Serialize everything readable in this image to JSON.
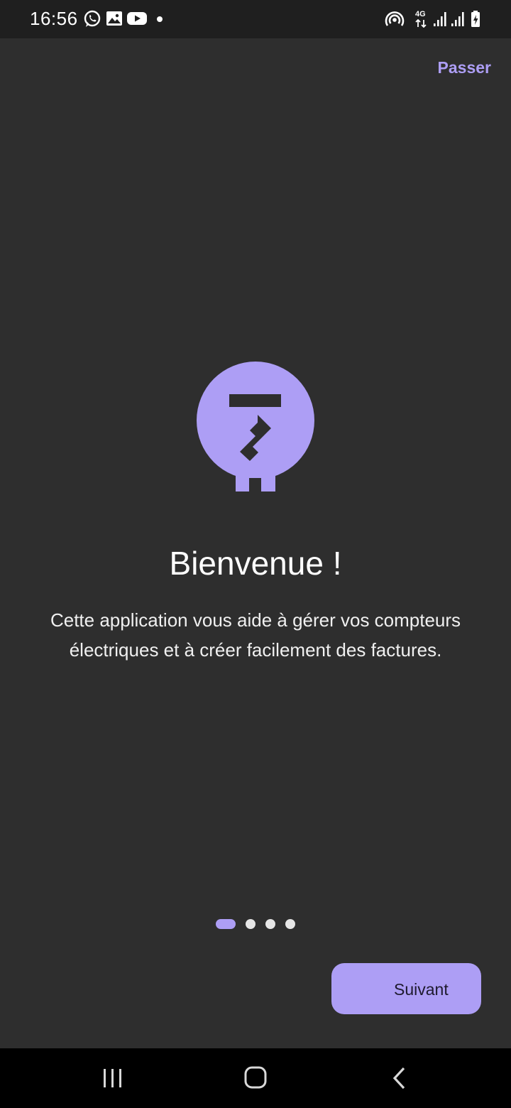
{
  "status_bar": {
    "time": "16:56",
    "left_icons": [
      "whatsapp-icon",
      "gallery-icon",
      "youtube-icon",
      "dot-icon"
    ],
    "right_icons": [
      "hotspot-icon",
      "4g-data-icon",
      "signal-icon",
      "signal-icon",
      "battery-charging-icon"
    ],
    "network_label": "4G"
  },
  "onboarding": {
    "skip_label": "Passer",
    "logo_icon": "electric-meter-icon",
    "title": "Bienvenue !",
    "description": "Cette application vous aide à gérer vos compteurs électriques et à créer facilement des factures.",
    "page_count": 4,
    "current_page": 1,
    "next_label": "Suivant"
  },
  "nav_bar": {
    "buttons": [
      "recent-apps-icon",
      "home-icon",
      "back-icon"
    ]
  },
  "colors": {
    "background": "#2e2e2e",
    "accent": "#ad9ef5",
    "status_bar": "#1f1f1f",
    "nav_bar": "#000000"
  }
}
